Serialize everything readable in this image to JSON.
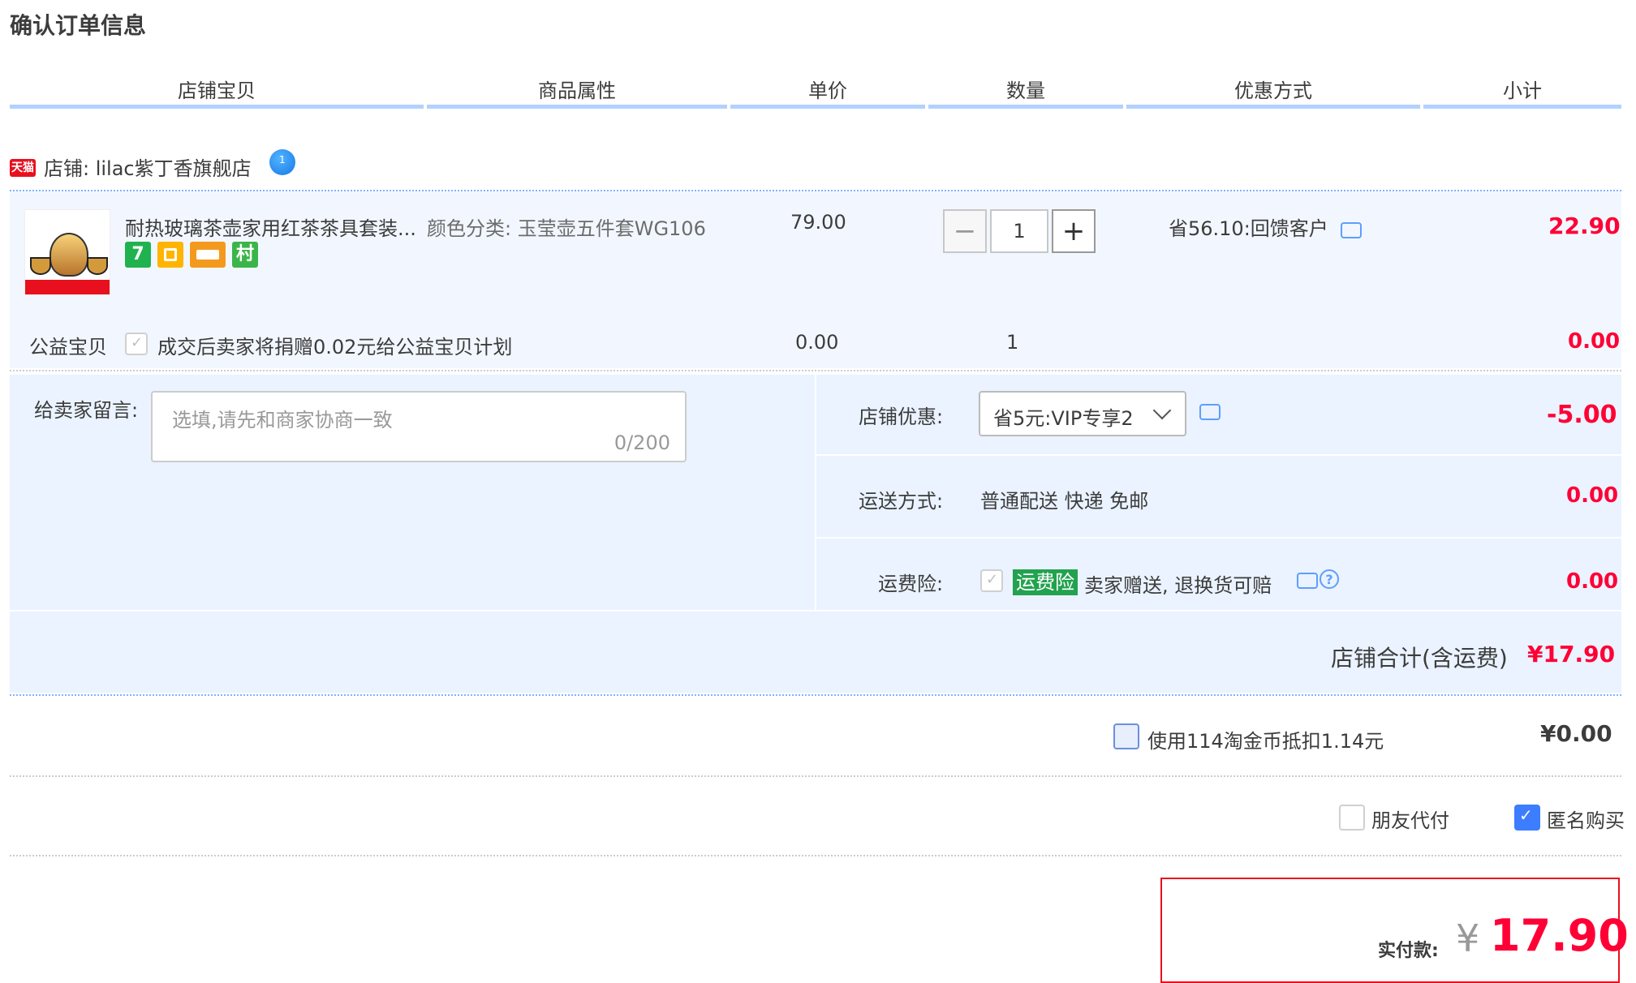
{
  "page": {
    "title": "确认订单信息"
  },
  "table_headers": [
    "店铺宝贝",
    "商品属性",
    "单价",
    "数量",
    "优惠方式",
    "小计"
  ],
  "shop": {
    "badge": "天猫",
    "name": "店铺: lilac紫丁香旗舰店",
    "ww_icon": "aliwangwang-icon"
  },
  "item": {
    "name": "耐热玻璃茶壶家用红茶茶具套装...",
    "attribute": "颜色分类: 玉莹壶五件套WG106",
    "price": "79.00",
    "quantity": "1",
    "promo": "省56.10:回馈客户",
    "subtotal": "22.90",
    "badges": [
      {
        "text": "7",
        "color": "#20b24f"
      },
      {
        "text": "",
        "color": "#ffb400"
      },
      {
        "text": "",
        "color": "#f39a1e"
      },
      {
        "text": "村",
        "color": "#3bb54a"
      }
    ]
  },
  "charity": {
    "label": "公益宝贝",
    "text": "成交后卖家将捐赠0.02元给公益宝贝计划",
    "price": "0.00",
    "qty": "1",
    "subtotal": "0.00"
  },
  "message": {
    "label": "给卖家留言:",
    "placeholder": "选填,请先和商家协商一致",
    "counter": "0/200"
  },
  "shop_discount": {
    "label": "店铺优惠:",
    "selected": "省5元:VIP专享2",
    "amount": "-5.00"
  },
  "shipping": {
    "label": "运送方式:",
    "value": "普通配送 快递 免邮",
    "amount": "0.00"
  },
  "insurance": {
    "label": "运费险:",
    "tag": "运费险",
    "text": "卖家赠送, 退换货可赔",
    "amount": "0.00"
  },
  "shop_total": {
    "label": "店铺合计(含运费)",
    "amount": "¥17.90"
  },
  "coins": {
    "label": "使用114淘金币抵扣1.14元",
    "amount": "¥0.00"
  },
  "friend_pay": {
    "label": "朋友代付"
  },
  "anonymous": {
    "label": "匿名购买"
  },
  "final": {
    "label": "实付款:",
    "currency": "¥",
    "amount": "17.90"
  }
}
